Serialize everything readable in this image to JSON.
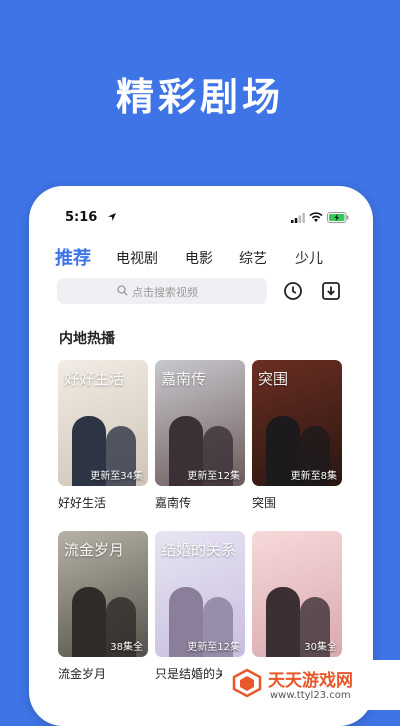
{
  "hero": {
    "title": "精彩剧场"
  },
  "status_bar": {
    "time": "5:16"
  },
  "tabs": [
    {
      "label": "推荐",
      "active": true
    },
    {
      "label": "电视剧",
      "active": false
    },
    {
      "label": "电影",
      "active": false
    },
    {
      "label": "综艺",
      "active": false
    },
    {
      "label": "少儿",
      "active": false
    }
  ],
  "search": {
    "placeholder": "点击搜索视频"
  },
  "section": {
    "title": "内地热播"
  },
  "dramas": [
    {
      "title": "好好生活",
      "badge": "更新至34集",
      "poster_text": "好好生活",
      "colors": [
        "#f2ece4",
        "#cfc4b8"
      ],
      "figure": "#2d3444"
    },
    {
      "title": "嘉南传",
      "badge": "更新至12集",
      "poster_text": "嘉南传",
      "colors": [
        "#c9c9cf",
        "#6d5a5a"
      ],
      "figure": "#3a3036"
    },
    {
      "title": "突围",
      "badge": "更新至8集",
      "poster_text": "突围",
      "colors": [
        "#6a2e22",
        "#2a1612"
      ],
      "figure": "#1c1a1c"
    },
    {
      "title": "流金岁月",
      "badge": "38集全",
      "poster_text": "流金岁月",
      "colors": [
        "#b7b2a6",
        "#55524b"
      ],
      "figure": "#2f2b28"
    },
    {
      "title": "只是结婚的关系",
      "badge": "更新至12集",
      "poster_text": "结婚的关系",
      "colors": [
        "#e8e4f2",
        "#c8bfe0"
      ],
      "figure": "#8a7e9a"
    },
    {
      "title": "",
      "badge": "30集全",
      "poster_text": "",
      "colors": [
        "#f7d9d9",
        "#d8a9b0"
      ],
      "figure": "#3b2f33"
    }
  ],
  "watermark": {
    "name": "天天游戏网",
    "url": "www.ttyl23.com"
  },
  "colors": {
    "background": "#3f74e6",
    "accent": "#3f74e6",
    "watermark": "#e8582c"
  }
}
